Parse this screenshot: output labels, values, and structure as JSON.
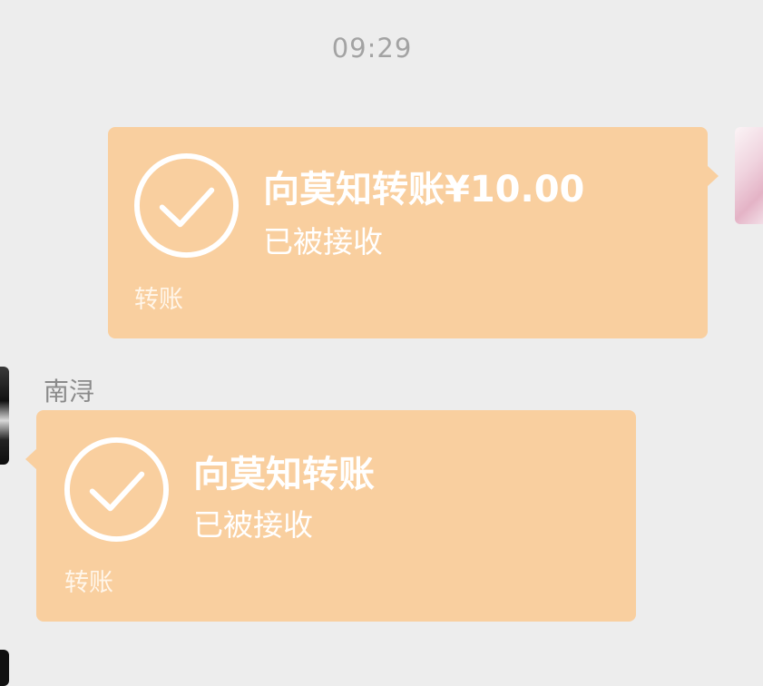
{
  "chat": {
    "timestamp": "09:29",
    "messages": [
      {
        "direction": "outgoing",
        "type": "transfer",
        "title": "向莫知转账¥10.00",
        "status": "已被接收",
        "label": "转账"
      },
      {
        "direction": "incoming",
        "sender": "南浔",
        "type": "transfer",
        "title": "向莫知转账",
        "status": "已被接收",
        "label": "转账"
      }
    ]
  },
  "colors": {
    "background": "#ededed",
    "transfer_bubble": "#f9cf9f",
    "timestamp_text": "#a3a3a3",
    "sender_text": "#8a8a8a"
  },
  "icons": {
    "transfer_status": "check-circle-icon"
  }
}
